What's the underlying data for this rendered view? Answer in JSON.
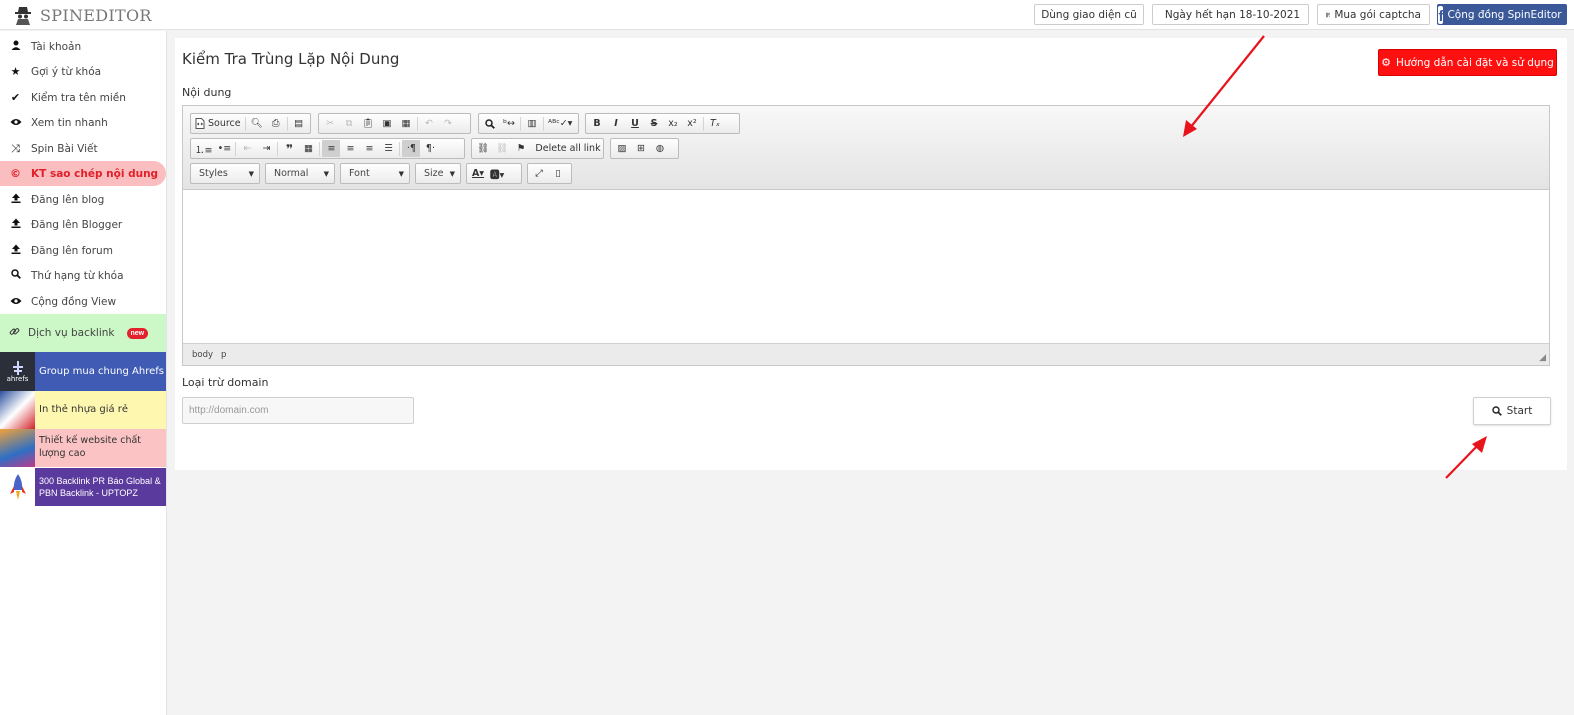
{
  "app": {
    "name": "SPINEDITOR"
  },
  "topbar": {
    "old_ui_label": "Dùng giao diện cũ",
    "expiry_label": "Ngày hết hạn 18-10-2021",
    "captcha_label": "Mua gói captcha",
    "community_label": "Cộng đồng SpinEditor"
  },
  "sidebar": {
    "items": [
      {
        "label": "Tài khoản",
        "icon": "user-icon"
      },
      {
        "label": "Gợi ý từ khóa",
        "icon": "star-icon"
      },
      {
        "label": "Kiểm tra tên miền",
        "icon": "check-icon"
      },
      {
        "label": "Xem tin nhanh",
        "icon": "eye-icon"
      },
      {
        "label": "Spin Bài Viết",
        "icon": "shuffle-icon"
      },
      {
        "label": "KT sao chép nội dung",
        "icon": "copyright-icon",
        "active": true
      },
      {
        "label": "Đăng lên blog",
        "icon": "upload-icon"
      },
      {
        "label": "Đăng lên Blogger",
        "icon": "upload-icon"
      },
      {
        "label": "Đăng lên forum",
        "icon": "upload-icon"
      },
      {
        "label": "Thứ hạng từ khóa",
        "icon": "search-icon"
      },
      {
        "label": "Cộng đồng View",
        "icon": "eye-icon"
      }
    ],
    "backlink": {
      "label": "Dịch vụ backlink",
      "badge": "new"
    },
    "ads": [
      {
        "text": "Group mua chung Ahrefs",
        "thumb_text": "ahrefs",
        "bg": "#3f5bb3"
      },
      {
        "text": "In thẻ nhựa giá rẻ",
        "bg": "#fdf7b0"
      },
      {
        "text": "Thiết kế website chất lượng cao",
        "bg": "#fbc3c3"
      },
      {
        "text": "300 Backlink PR Báo Global & PBN Backlink - UPTOPZ",
        "bg": "#5b3a9e"
      }
    ]
  },
  "main": {
    "title": "Kiểm Tra Trùng Lặp Nội Dung",
    "guide_button": "Hướng dẫn cài đặt và sử dụng",
    "content_label": "Nội dung",
    "editor": {
      "source_label": "Source",
      "delete_all_link_label": "Delete all link",
      "styles_combo": "Styles",
      "format_combo": "Normal",
      "font_combo": "Font",
      "size_combo": "Size",
      "path": [
        "body",
        "p"
      ]
    },
    "exclude_label": "Loại trừ domain",
    "exclude_placeholder": "http://domain.com",
    "start_button": "Start"
  },
  "colors": {
    "accent_red": "#ff1010",
    "active_bg": "#fbbec0",
    "facebook": "#3b5998",
    "arrow": "#e8141c"
  }
}
